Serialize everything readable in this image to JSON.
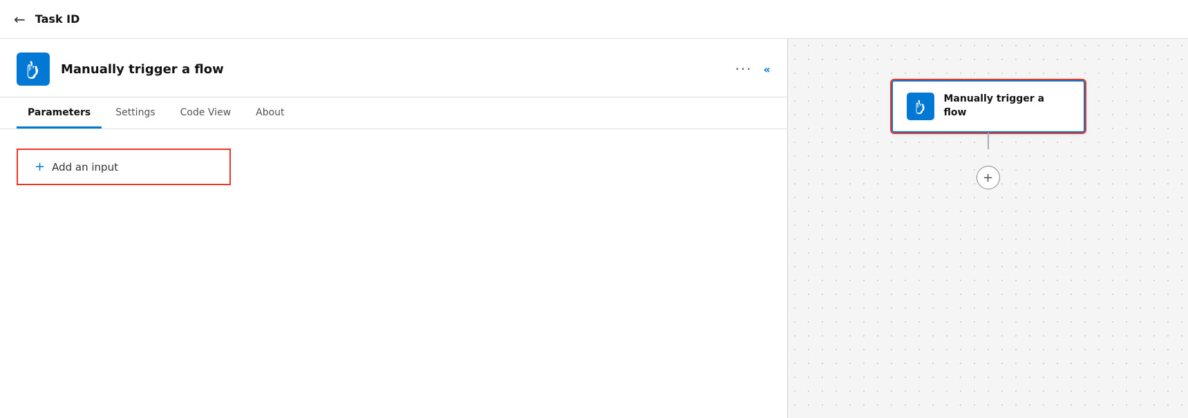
{
  "header": {
    "back_label": "←",
    "title": "Task ID"
  },
  "trigger": {
    "title": "Manually trigger a flow",
    "icon_alt": "trigger-icon",
    "dots_label": "···",
    "collapse_label": "«"
  },
  "tabs": [
    {
      "label": "Parameters",
      "active": true
    },
    {
      "label": "Settings",
      "active": false
    },
    {
      "label": "Code View",
      "active": false
    },
    {
      "label": "About",
      "active": false
    }
  ],
  "add_input": {
    "plus_label": "+",
    "label": "Add an input"
  },
  "canvas": {
    "node_title": "Manually trigger a flow",
    "add_node_label": "+"
  },
  "colors": {
    "accent": "#0078d4",
    "red_border": "#cc2200"
  }
}
